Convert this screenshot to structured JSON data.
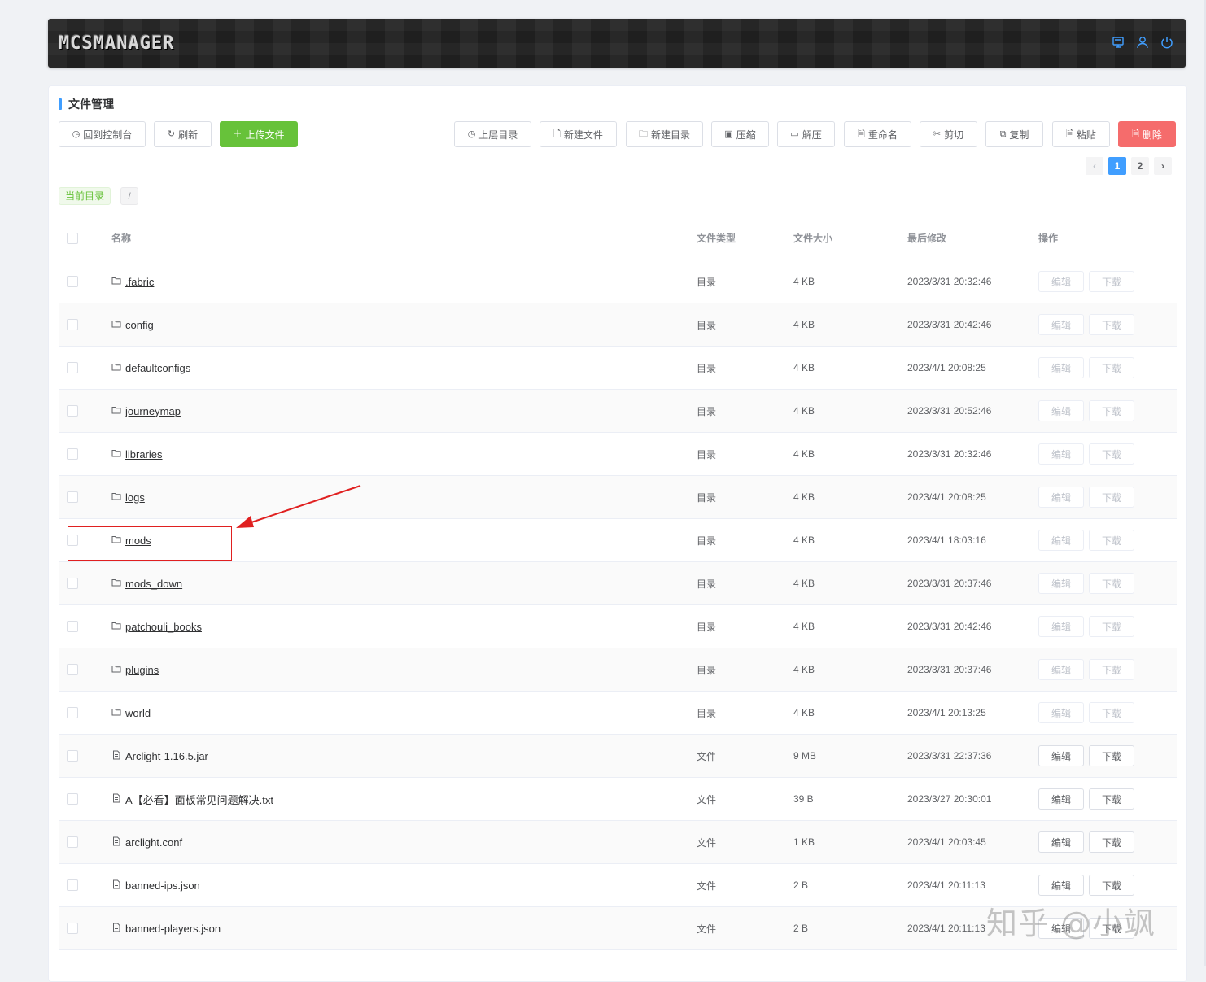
{
  "header": {
    "logo": "MCSMANAGER",
    "icons": [
      "monitor-icon",
      "user-icon",
      "power-icon"
    ],
    "accent": "#409eff"
  },
  "panel": {
    "title": "文件管理",
    "toolbar_left": [
      {
        "label": "回到控制台",
        "icon": "clock-icon"
      },
      {
        "label": "刷新",
        "icon": "refresh-icon"
      },
      {
        "label": "上传文件",
        "icon": "plus-icon"
      }
    ],
    "toolbar_right": [
      {
        "label": "上层目录",
        "icon": "clock-icon"
      },
      {
        "label": "新建文件",
        "icon": "new-file-icon"
      },
      {
        "label": "新建目录",
        "icon": "new-folder-icon"
      },
      {
        "label": "压缩",
        "icon": "compress-icon"
      },
      {
        "label": "解压",
        "icon": "extract-icon"
      },
      {
        "label": "重命名",
        "icon": "rename-icon"
      },
      {
        "label": "剪切",
        "icon": "scissors-icon"
      },
      {
        "label": "复制",
        "icon": "copy-icon"
      },
      {
        "label": "粘贴",
        "icon": "paste-icon"
      },
      {
        "label": "删除",
        "icon": "delete-icon"
      }
    ],
    "pagination": {
      "pages": [
        "1",
        "2"
      ],
      "current": "1",
      "prev": "‹",
      "next": "›"
    },
    "current_dir_label": "当前目录",
    "current_path": "/"
  },
  "table": {
    "headers": {
      "name": "名称",
      "type": "文件类型",
      "size": "文件大小",
      "modified": "最后修改",
      "actions": "操作"
    },
    "edit_label": "编辑",
    "download_label": "下载",
    "rows": [
      {
        "name": ".fabric",
        "type": "目录",
        "size": "4 KB",
        "modified": "2023/3/31 20:32:46",
        "kind": "folder"
      },
      {
        "name": "config",
        "type": "目录",
        "size": "4 KB",
        "modified": "2023/3/31 20:42:46",
        "kind": "folder"
      },
      {
        "name": "defaultconfigs",
        "type": "目录",
        "size": "4 KB",
        "modified": "2023/4/1 20:08:25",
        "kind": "folder"
      },
      {
        "name": "journeymap",
        "type": "目录",
        "size": "4 KB",
        "modified": "2023/3/31 20:52:46",
        "kind": "folder"
      },
      {
        "name": "libraries",
        "type": "目录",
        "size": "4 KB",
        "modified": "2023/3/31 20:32:46",
        "kind": "folder"
      },
      {
        "name": "logs",
        "type": "目录",
        "size": "4 KB",
        "modified": "2023/4/1 20:08:25",
        "kind": "folder"
      },
      {
        "name": "mods",
        "type": "目录",
        "size": "4 KB",
        "modified": "2023/4/1 18:03:16",
        "kind": "folder"
      },
      {
        "name": "mods_down",
        "type": "目录",
        "size": "4 KB",
        "modified": "2023/3/31 20:37:46",
        "kind": "folder"
      },
      {
        "name": "patchouli_books",
        "type": "目录",
        "size": "4 KB",
        "modified": "2023/3/31 20:42:46",
        "kind": "folder"
      },
      {
        "name": "plugins",
        "type": "目录",
        "size": "4 KB",
        "modified": "2023/3/31 20:37:46",
        "kind": "folder"
      },
      {
        "name": "world",
        "type": "目录",
        "size": "4 KB",
        "modified": "2023/4/1 20:13:25",
        "kind": "folder"
      },
      {
        "name": "Arclight-1.16.5.jar",
        "type": "文件",
        "size": "9 MB",
        "modified": "2023/3/31 22:37:36",
        "kind": "file"
      },
      {
        "name": "A【必看】面板常见问题解决.txt",
        "type": "文件",
        "size": "39 B",
        "modified": "2023/3/27 20:30:01",
        "kind": "file"
      },
      {
        "name": "arclight.conf",
        "type": "文件",
        "size": "1 KB",
        "modified": "2023/4/1 20:03:45",
        "kind": "file"
      },
      {
        "name": "banned-ips.json",
        "type": "文件",
        "size": "2 B",
        "modified": "2023/4/1 20:11:13",
        "kind": "file"
      },
      {
        "name": "banned-players.json",
        "type": "文件",
        "size": "2 B",
        "modified": "2023/4/1 20:11:13",
        "kind": "file"
      }
    ]
  },
  "watermark": "知乎 @小飒",
  "colors": {
    "success": "#67c23a",
    "danger": "#f56c6c",
    "primary": "#409eff",
    "annotation": "#e02020"
  }
}
